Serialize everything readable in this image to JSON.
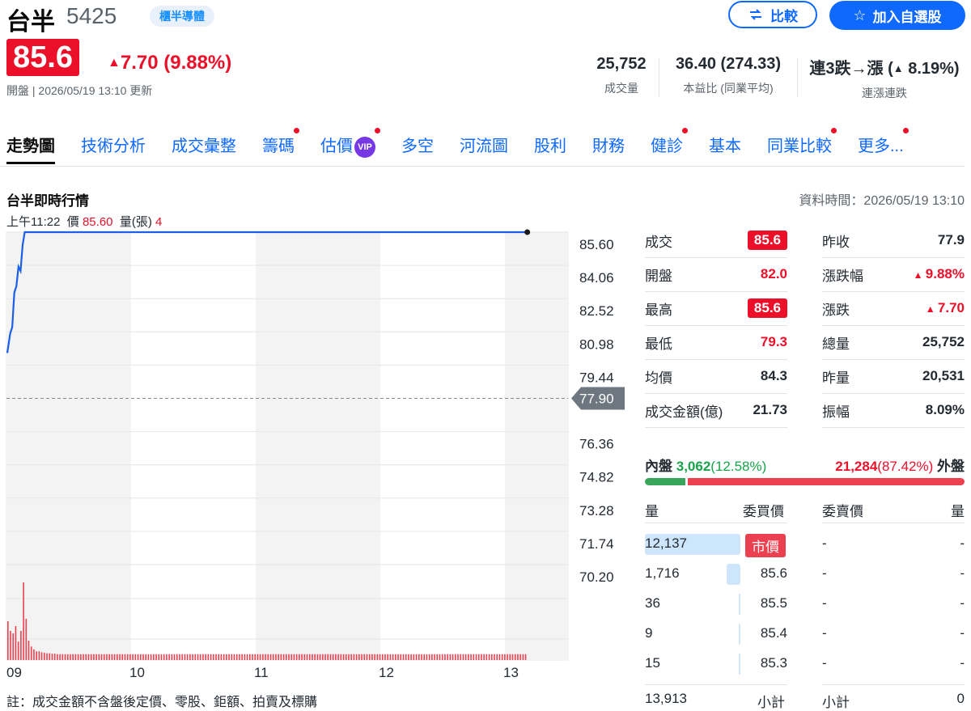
{
  "header": {
    "name": "台半",
    "code": "5425",
    "tag": "櫃半導體",
    "compare_label": "比較",
    "watchlist_label": "加入自選股",
    "price": "85.6",
    "change": "7.70 (9.88%)",
    "updated": "開盤 | 2026/05/19 13:10 更新"
  },
  "stats": [
    {
      "value": "25,752",
      "label": "成交量"
    },
    {
      "value": "36.40 (274.33)",
      "label": "本益比 (同業平均)"
    },
    {
      "value_a": "連3跌→漲 (",
      "value_b": "8.19%)",
      "label": "連漲連跌"
    }
  ],
  "tabs": [
    {
      "label": "走勢圖",
      "active": true
    },
    {
      "label": "技術分析"
    },
    {
      "label": "成交彙整"
    },
    {
      "label": "籌碼",
      "dot": true
    },
    {
      "label": "估價",
      "vip": "VIP",
      "dot": true
    },
    {
      "label": "多空"
    },
    {
      "label": "河流圖"
    },
    {
      "label": "股利"
    },
    {
      "label": "財務"
    },
    {
      "label": "健診",
      "dot": true
    },
    {
      "label": "基本"
    },
    {
      "label": "同業比較",
      "dot": true
    },
    {
      "label": "更多...",
      "dot": true
    }
  ],
  "section": {
    "title": "台半即時行情",
    "data_time": "資料時間：2026/05/19 13:10",
    "hover": {
      "time": "上午11:22",
      "price_label": "價",
      "price": "85.60",
      "vol_label": "量(張)",
      "vol": "4"
    }
  },
  "chart_data": {
    "type": "line",
    "y_ticks": [
      "85.60",
      "84.06",
      "82.52",
      "80.98",
      "79.44",
      "77.90",
      "76.36",
      "74.82",
      "73.28",
      "71.74",
      "70.20"
    ],
    "x_ticks": [
      "09",
      "10",
      "11",
      "12",
      "13"
    ],
    "ylim": [
      70.2,
      85.6
    ],
    "ref_price": 77.9,
    "ref_label": "77.90",
    "price_series": [
      {
        "t": "09:00",
        "y": 80.0
      },
      {
        "t": "09:01",
        "y": 80.9
      },
      {
        "t": "09:02",
        "y": 81.2
      },
      {
        "t": "09:03",
        "y": 82.8
      },
      {
        "t": "09:04",
        "y": 83.1
      },
      {
        "t": "09:05",
        "y": 84.0
      },
      {
        "t": "09:06",
        "y": 83.8
      },
      {
        "t": "09:07",
        "y": 85.0
      },
      {
        "t": "09:08",
        "y": 85.6
      },
      {
        "t": "13:10",
        "y": 85.6
      }
    ],
    "volume_series": [
      80,
      60,
      55,
      70,
      38,
      60,
      160,
      85,
      40,
      28,
      22,
      18,
      18,
      16,
      15,
      14,
      14,
      13,
      13,
      12,
      12,
      12,
      12,
      12,
      12,
      12,
      12,
      12,
      12,
      12,
      12,
      12,
      12,
      12,
      12,
      12,
      12,
      12,
      12,
      12
    ],
    "colors": {
      "line": "#1a5fe6",
      "volume": "#eb4050",
      "ref": "#828a93"
    }
  },
  "quote": {
    "left": [
      {
        "label": "成交",
        "value": "85.6",
        "pill": true
      },
      {
        "label": "開盤",
        "value": "82.0",
        "color": "red"
      },
      {
        "label": "最高",
        "value": "85.6",
        "pill": true
      },
      {
        "label": "最低",
        "value": "79.3",
        "color": "red"
      },
      {
        "label": "均價",
        "value": "84.3"
      },
      {
        "label": "成交金額(億)",
        "value": "21.73"
      }
    ],
    "right": [
      {
        "label": "昨收",
        "value": "77.9"
      },
      {
        "label": "漲跌幅",
        "value": "9.88%",
        "color": "red",
        "up": true
      },
      {
        "label": "漲跌",
        "value": "7.70",
        "color": "red",
        "up": true
      },
      {
        "label": "總量",
        "value": "25,752"
      },
      {
        "label": "昨量",
        "value": "20,531"
      },
      {
        "label": "振幅",
        "value": "8.09%"
      }
    ]
  },
  "inout": {
    "in_label": "內盤",
    "in_value": "3,062",
    "in_pct": "(12.58%)",
    "out_value": "21,284",
    "out_pct": "(87.42%)",
    "out_label": "外盤",
    "in_fraction": 0.1258
  },
  "orderbook": {
    "headers": [
      "量",
      "委買價",
      "委賣價",
      "量"
    ],
    "rows": [
      {
        "bid_vol": "12,137",
        "bid_price": "市價",
        "ask_price": "-",
        "ask_vol": "-",
        "bar": 1.0,
        "market": true
      },
      {
        "bid_vol": "1,716",
        "bid_price": "85.6",
        "ask_price": "-",
        "ask_vol": "-",
        "bar": 0.14
      },
      {
        "bid_vol": "36",
        "bid_price": "85.5",
        "ask_price": "-",
        "ask_vol": "-",
        "bar": 0.01
      },
      {
        "bid_vol": "9",
        "bid_price": "85.4",
        "ask_price": "-",
        "ask_vol": "-",
        "bar": 0.01
      },
      {
        "bid_vol": "15",
        "bid_price": "85.3",
        "ask_price": "-",
        "ask_vol": "-",
        "bar": 0.01
      }
    ],
    "subtotal_bid": "13,913",
    "subtotal_label": "小計",
    "subtotal_ask": "0"
  },
  "note": "註：成交金額不含盤後定價、零股、鉅額、拍賣及標購"
}
